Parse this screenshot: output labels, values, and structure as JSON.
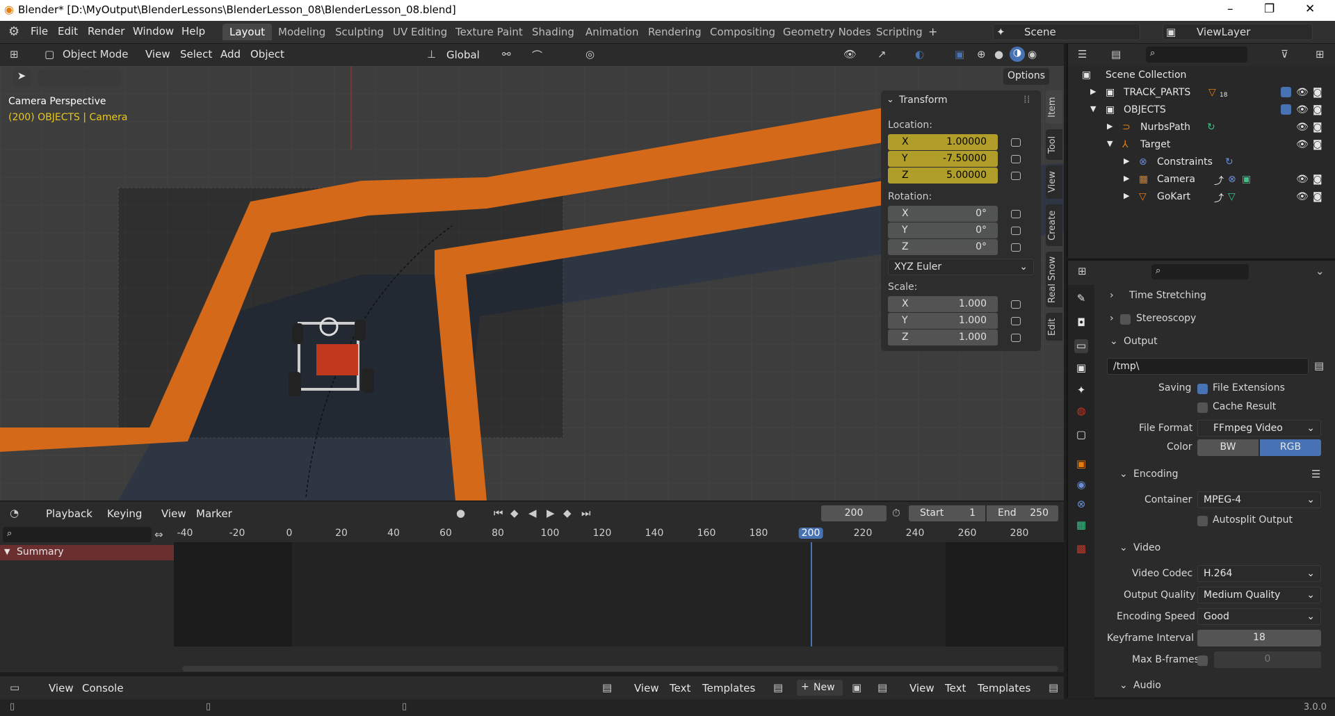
{
  "window": {
    "title": "Blender* [D:\\MyOutput\\BlenderLessons\\BlenderLesson_08\\BlenderLesson_08.blend]",
    "controls": [
      "–",
      "❐",
      "✕"
    ]
  },
  "menus": [
    "File",
    "Edit",
    "Render",
    "Window",
    "Help"
  ],
  "workspaces": [
    "Layout",
    "Modeling",
    "Sculpting",
    "UV Editing",
    "Texture Paint",
    "Shading",
    "Animation",
    "Rendering",
    "Compositing",
    "Geometry Nodes",
    "Scripting"
  ],
  "active_workspace": "Layout",
  "scene": "Scene",
  "view_layer": "ViewLayer",
  "viewport": {
    "mode": "Object Mode",
    "menus": [
      "View",
      "Select",
      "Add",
      "Object"
    ],
    "orientation": "Global",
    "options": "Options",
    "perspective_label": "Camera Perspective",
    "object_label": "(200) OBJECTS | Camera"
  },
  "transform": {
    "title": "Transform",
    "location_label": "Location:",
    "location": [
      {
        "axis": "X",
        "value": "1.00000"
      },
      {
        "axis": "Y",
        "value": "-7.50000"
      },
      {
        "axis": "Z",
        "value": "5.00000"
      }
    ],
    "rotation_label": "Rotation:",
    "rotation": [
      {
        "axis": "X",
        "value": "0°"
      },
      {
        "axis": "Y",
        "value": "0°"
      },
      {
        "axis": "Z",
        "value": "0°"
      }
    ],
    "rotation_mode": "XYZ Euler",
    "scale_label": "Scale:",
    "scale": [
      {
        "axis": "X",
        "value": "1.000"
      },
      {
        "axis": "Y",
        "value": "1.000"
      },
      {
        "axis": "Z",
        "value": "1.000"
      }
    ]
  },
  "side_tabs": [
    "Item",
    "Tool",
    "View",
    "Create",
    "Real Snow",
    "Edit"
  ],
  "outliner": {
    "root": "Scene Collection",
    "rows": [
      {
        "label": "TRACK_PARTS",
        "extra": "18"
      },
      {
        "label": "OBJECTS"
      },
      {
        "label": "NurbsPath"
      },
      {
        "label": "Target"
      },
      {
        "label": "Constraints"
      },
      {
        "label": "Camera"
      },
      {
        "label": "GoKart"
      }
    ]
  },
  "properties": {
    "time_stretching": "Time Stretching",
    "stereoscopy": "Stereoscopy",
    "output": "Output",
    "path": "/tmp\\",
    "saving_label": "Saving",
    "file_extensions": "File Extensions",
    "cache_result": "Cache Result",
    "file_format_label": "File Format",
    "file_format": "FFmpeg Video",
    "color_label": "Color",
    "color_bw": "BW",
    "color_rgb": "RGB",
    "encoding": "Encoding",
    "container_label": "Container",
    "container": "MPEG-4",
    "autosplit": "Autosplit Output",
    "video": "Video",
    "codec_label": "Video Codec",
    "codec": "H.264",
    "quality_label": "Output Quality",
    "quality": "Medium Quality",
    "speed_label": "Encoding Speed",
    "speed": "Good",
    "keyframe_label": "Keyframe Interval",
    "keyframe": "18",
    "bframes_label": "Max B-frames",
    "bframes": "0",
    "audio": "Audio"
  },
  "timeline": {
    "menus": [
      "Playback",
      "Keying",
      "View",
      "Marker"
    ],
    "current_frame": "200",
    "start_label": "Start",
    "start": "1",
    "end_label": "End",
    "end": "250",
    "summary": "Summary",
    "ticks": [
      "-40",
      "-20",
      "0",
      "20",
      "40",
      "60",
      "80",
      "100",
      "120",
      "140",
      "160",
      "180",
      "200",
      "220",
      "240",
      "260",
      "280"
    ]
  },
  "bottom": {
    "left_menus": [
      "View",
      "Console"
    ],
    "mid_menus": [
      "View",
      "Text",
      "Templates"
    ],
    "new": "New",
    "right_menus": [
      "View",
      "Text",
      "Templates"
    ]
  },
  "version": "3.0.0"
}
